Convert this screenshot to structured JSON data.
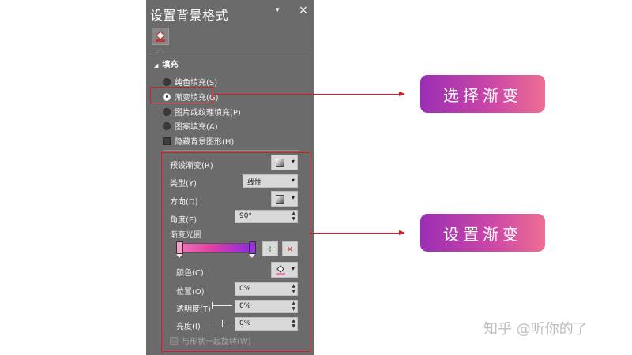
{
  "pane": {
    "title": "设置背景格式",
    "menu_glyph": "▾",
    "close_glyph": "×",
    "section_label": "填充",
    "section_glyph": "◢"
  },
  "fill_options": [
    {
      "label": "纯色填充(S)",
      "selected": false
    },
    {
      "label": "渐变填充(G)",
      "selected": true
    },
    {
      "label": "图片或纹理填充(P)",
      "selected": false
    },
    {
      "label": "图案填充(A)",
      "selected": false
    }
  ],
  "hide_graphics": {
    "label": "隐藏背景图形(H)",
    "checked": false
  },
  "gradient": {
    "preset_label": "预设渐变(R)",
    "type_label": "类型(Y)",
    "type_value": "线性",
    "direction_label": "方向(D)",
    "angle_label": "角度(E)",
    "angle_value": "90°",
    "stops_label": "渐变光圈",
    "add_stop_glyph": "+",
    "remove_stop_glyph": "×",
    "color_label": "颜色(C)",
    "position_label": "位置(O)",
    "position_value": "0%",
    "transparency_label": "透明度(T)",
    "transparency_value": "0%",
    "brightness_label": "亮度(I)",
    "brightness_value": "0%",
    "rotate_label": "与形状一起旋转(W)",
    "dropdown_glyph": "▾",
    "spin_up_glyph": "▲",
    "spin_down_glyph": "▼",
    "stop_colors": [
      "#f5a0c8",
      "#9b30e0"
    ],
    "bar_colors": [
      "#f07ab8",
      "#e040a0",
      "#8a2be2"
    ]
  },
  "callouts": {
    "select_gradient": "选择渐变",
    "set_gradient": "设置渐变"
  },
  "watermark": "知乎 @听你的了",
  "colors": {
    "pane_bg": "#6b6b6b",
    "annotation_red": "#d21f1f",
    "callout_start": "#9b2fb4",
    "callout_end": "#ee6d94"
  }
}
